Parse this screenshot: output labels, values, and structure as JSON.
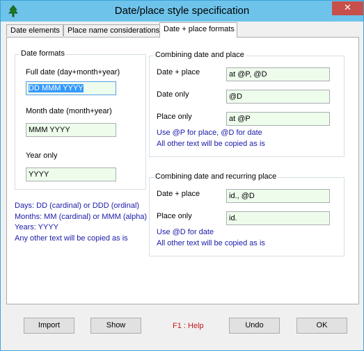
{
  "window": {
    "title": "Date/place style specification",
    "close_glyph": "✕",
    "app_icon": "tree-icon"
  },
  "tabs": [
    {
      "label": "Date elements",
      "active": false
    },
    {
      "label": "Place name considerations",
      "active": false
    },
    {
      "label": "Date + place formats",
      "active": true
    }
  ],
  "date_formats": {
    "legend": "Date formats",
    "full_date_label": "Full date (day+month+year)",
    "full_date_value": "DD MMM YYYY",
    "month_date_label": "Month date (month+year)",
    "month_date_value": "MMM YYYY",
    "year_only_label": "Year only",
    "year_only_value": "YYYY"
  },
  "date_help": {
    "days": "Days: DD (cardinal) or DDD (ordinal)",
    "months": "Months: MM (cardinal) or MMM (alpha)",
    "years": "Years: YYYY",
    "other": "Any other text will be copied as is"
  },
  "combining": {
    "legend": "Combining date and place",
    "date_place_label": "Date + place",
    "date_place_value": "at @P, @D",
    "date_only_label": "Date only",
    "date_only_value": "@D",
    "place_only_label": "Place only",
    "place_only_value": "at @P",
    "hint1": "Use @P for place, @D for date",
    "hint2": "All other text will be copied as is"
  },
  "recurring": {
    "legend": "Combining date and recurring place",
    "date_place_label": "Date + place",
    "date_place_value": "id., @D",
    "place_only_label": "Place only",
    "place_only_value": "id.",
    "hint1": "Use @D for date",
    "hint2": "All other text will be copied as is"
  },
  "buttons": {
    "import": "Import",
    "show": "Show",
    "help": "F1 : Help",
    "undo": "Undo",
    "ok": "OK"
  },
  "colors": {
    "titlebar": "#6ec3ea",
    "close": "#c7504b",
    "field_bg": "#eefcec",
    "info_text": "#1a1aa8",
    "help_text": "#c01818"
  }
}
